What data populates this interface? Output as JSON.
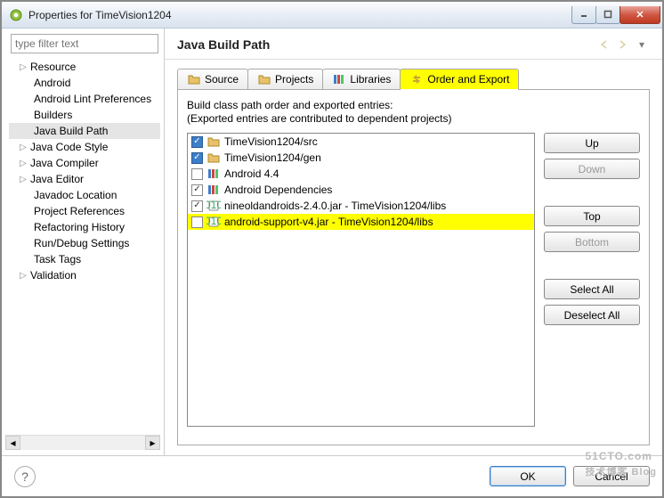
{
  "window": {
    "title": "Properties for TimeVision1204"
  },
  "filter_placeholder": "type filter text",
  "tree": [
    {
      "label": "Resource",
      "expandable": true
    },
    {
      "label": "Android",
      "expandable": false,
      "child": true
    },
    {
      "label": "Android Lint Preferences",
      "expandable": false,
      "child": true
    },
    {
      "label": "Builders",
      "expandable": false,
      "child": true
    },
    {
      "label": "Java Build Path",
      "expandable": false,
      "child": true,
      "selected": true
    },
    {
      "label": "Java Code Style",
      "expandable": true
    },
    {
      "label": "Java Compiler",
      "expandable": true
    },
    {
      "label": "Java Editor",
      "expandable": true
    },
    {
      "label": "Javadoc Location",
      "expandable": false,
      "child": true
    },
    {
      "label": "Project References",
      "expandable": false,
      "child": true
    },
    {
      "label": "Refactoring History",
      "expandable": false,
      "child": true
    },
    {
      "label": "Run/Debug Settings",
      "expandable": false,
      "child": true
    },
    {
      "label": "Task Tags",
      "expandable": false,
      "child": true
    },
    {
      "label": "Validation",
      "expandable": true
    }
  ],
  "page_title": "Java Build Path",
  "tabs": [
    {
      "label": "Source",
      "icon": "folder"
    },
    {
      "label": "Projects",
      "icon": "folder"
    },
    {
      "label": "Libraries",
      "icon": "books"
    },
    {
      "label": "Order and Export",
      "icon": "arrows",
      "active": true,
      "highlight": true
    }
  ],
  "desc_line1": "Build class path order and exported entries:",
  "desc_line2": "(Exported entries are contributed to dependent projects)",
  "entries": [
    {
      "checked": true,
      "blue": true,
      "icon": "folder",
      "label": "TimeVision1204/src"
    },
    {
      "checked": true,
      "blue": true,
      "icon": "folder",
      "label": "TimeVision1204/gen"
    },
    {
      "checked": false,
      "blue": false,
      "icon": "books",
      "label": "Android 4.4"
    },
    {
      "checked": true,
      "blue": false,
      "icon": "books",
      "label": "Android Dependencies"
    },
    {
      "checked": true,
      "blue": false,
      "icon": "jar",
      "label": "nineoldandroids-2.4.0.jar - TimeVision1204/libs"
    },
    {
      "checked": false,
      "blue": false,
      "icon": "jar",
      "label": "android-support-v4.jar - TimeVision1204/libs",
      "highlight": true
    }
  ],
  "buttons": {
    "up": "Up",
    "down": "Down",
    "top": "Top",
    "bottom": "Bottom",
    "select_all": "Select All",
    "deselect_all": "Deselect All"
  },
  "footer": {
    "ok": "OK",
    "cancel": "Cancel"
  },
  "watermark": {
    "big": "51CTO.com",
    "small": "技术博客 Blog"
  }
}
